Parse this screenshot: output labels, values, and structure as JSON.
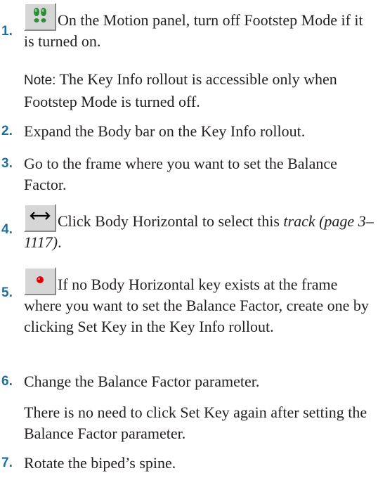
{
  "steps": [
    {
      "number": "1.",
      "icon": "footsteps-icon",
      "text": "On the Motion panel, turn off Footstep Mode if it is turned on."
    },
    {
      "note_label": "Note:",
      "note_text": " The Key Info rollout is accessible only when Footstep Mode is turned off."
    },
    {
      "number": "2.",
      "text": "Expand the Body bar on the Key Info rollout."
    },
    {
      "number": "3.",
      "text": "Go to the frame where you want to set the Balance Factor."
    },
    {
      "number": "4.",
      "icon": "horizontal-arrows-icon",
      "text": "Click Body Horizontal to select this ",
      "link_text": "track (page 3–1117)",
      "text_end": "."
    },
    {
      "number": "5.",
      "icon": "set-key-icon",
      "text": "If no Body Horizontal key exists at the frame where you want to set the Balance Factor, create one by clicking Set Key in the Key Info rollout."
    },
    {
      "number": "6.",
      "text": "Change the Balance Factor parameter."
    },
    {
      "para": "There is no need to click Set Key again after setting the Balance Factor parameter."
    },
    {
      "number": "7.",
      "text": "Rotate the biped’s spine."
    }
  ],
  "colors": {
    "step_number": "#1d6fa0",
    "text": "#231f20",
    "button_face": "#d6d6d6",
    "footsteps_green": "#2e8b3a",
    "key_red": "#e00000"
  }
}
